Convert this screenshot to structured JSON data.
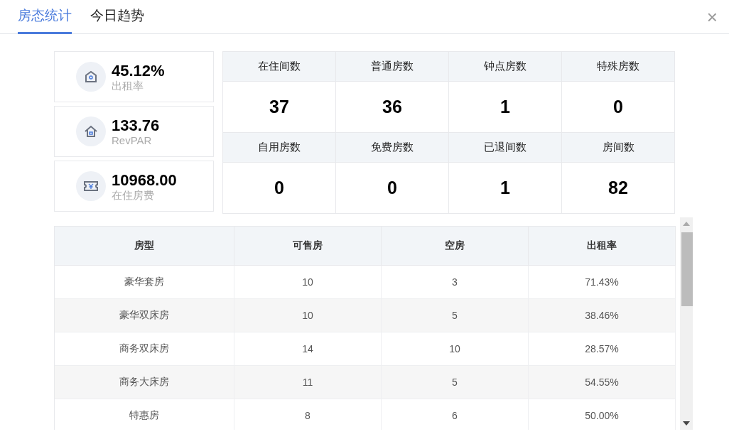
{
  "tabs": [
    {
      "label": "房态统计",
      "selected": true
    },
    {
      "label": "今日趋势",
      "selected": false
    }
  ],
  "close": {
    "label": "×"
  },
  "summary_cards": [
    {
      "kind": "occupancy",
      "value": "45.12%",
      "label": "出租率"
    },
    {
      "kind": "revpar",
      "value": "133.76",
      "label": "RevPAR"
    },
    {
      "kind": "revenue",
      "value": "10968.00",
      "label": "在住房费"
    }
  ],
  "room_counts": [
    {
      "label": "在住间数",
      "value": "37"
    },
    {
      "label": "普通房数",
      "value": "36"
    },
    {
      "label": "钟点房数",
      "value": "1"
    },
    {
      "label": "特殊房数",
      "value": "0"
    },
    {
      "label": "自用房数",
      "value": "0"
    },
    {
      "label": "免费房数",
      "value": "0"
    },
    {
      "label": "已退间数",
      "value": "1"
    },
    {
      "label": "房间数",
      "value": "82"
    }
  ],
  "table": {
    "columns": [
      "房型",
      "可售房",
      "空房",
      "出租率"
    ],
    "rows": [
      [
        "豪华套房",
        "10",
        "3",
        "71.43%"
      ],
      [
        "豪华双床房",
        "10",
        "5",
        "38.46%"
      ],
      [
        "商务双床房",
        "14",
        "10",
        "28.57%"
      ],
      [
        "商务大床房",
        "11",
        "5",
        "54.55%"
      ],
      [
        "特惠房",
        "8",
        "6",
        "50.00%"
      ]
    ]
  }
}
